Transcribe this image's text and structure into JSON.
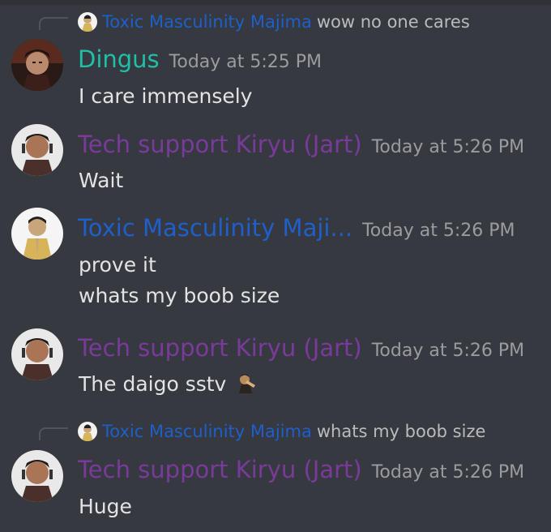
{
  "colors": {
    "background": "#36393f",
    "reply_name_majima": "#1f5fcc",
    "dingus": "#1fbfa8",
    "kiryu": "#7a3a9c",
    "majima": "#1f5fcc",
    "timestamp": "#9a9ca1",
    "text": "#e2e3e5"
  },
  "messages": [
    {
      "reply": {
        "name": "Toxic Masculinity Majima",
        "text": "wow no one cares",
        "avatar_icon": "majima-avatar-icon"
      },
      "author": "Dingus",
      "timestamp": "Today at 5:25 PM",
      "avatar_icon": "dingus-avatar-icon",
      "lines": [
        "I care immensely"
      ]
    },
    {
      "author": "Tech support Kiryu (Jart)",
      "timestamp": "Today at 5:26 PM",
      "avatar_icon": "kiryu-avatar-icon",
      "lines": [
        "Wait"
      ]
    },
    {
      "author": "Toxic Masculinity Maji...",
      "timestamp": "Today at 5:26 PM",
      "avatar_icon": "majima-avatar-icon",
      "lines": [
        "prove it",
        "whats my boob size"
      ]
    },
    {
      "author": "Tech support Kiryu (Jart)",
      "timestamp": "Today at 5:26 PM",
      "avatar_icon": "kiryu-avatar-icon",
      "lines": [
        "The daigo sstv"
      ],
      "emoji_icon": "custom-emoji-icon"
    },
    {
      "reply": {
        "name": "Toxic Masculinity Majima",
        "text": "whats my boob size",
        "avatar_icon": "majima-avatar-icon"
      },
      "author": "Tech support Kiryu (Jart)",
      "timestamp": "Today at 5:26 PM",
      "avatar_icon": "kiryu-avatar-icon",
      "lines": [
        "Huge"
      ]
    }
  ]
}
